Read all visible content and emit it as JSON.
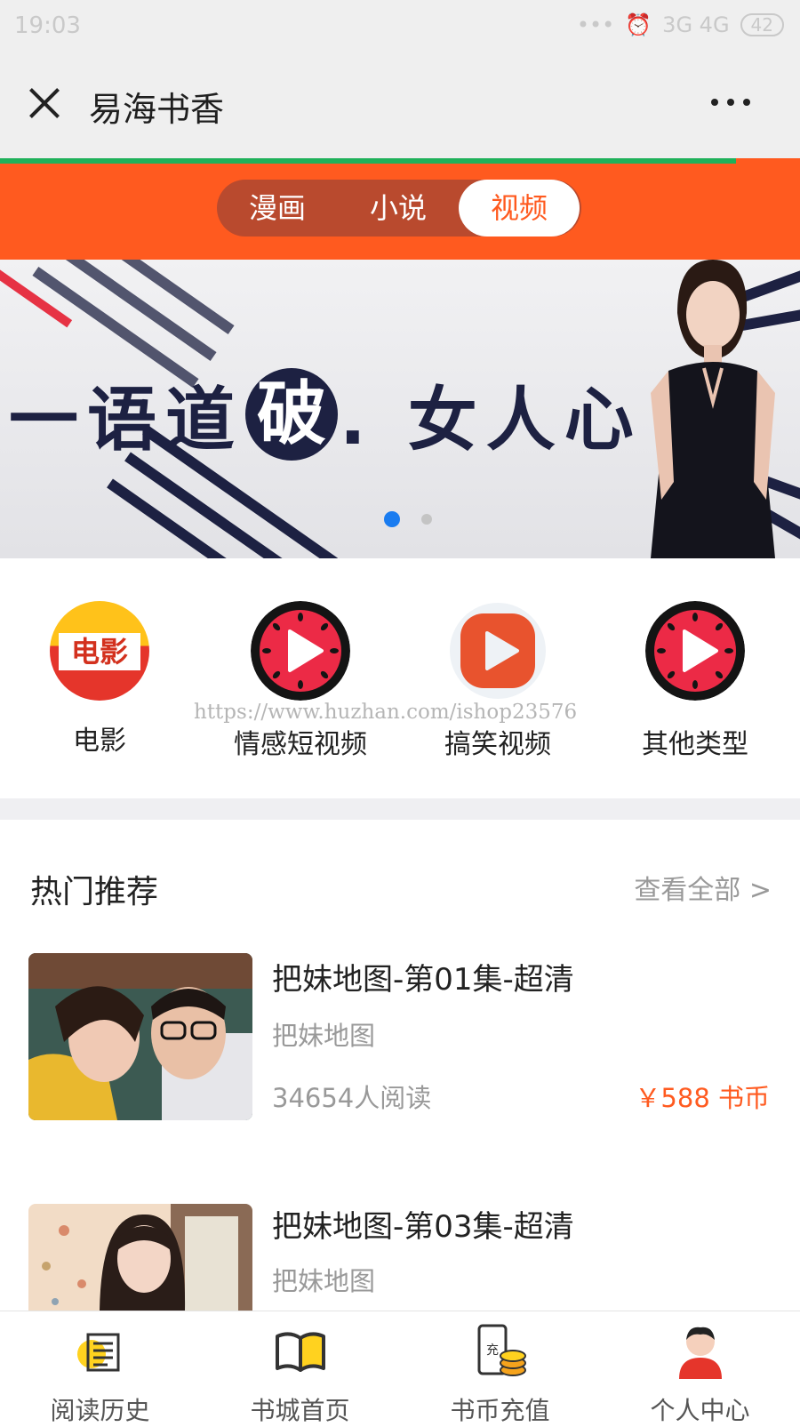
{
  "status_bar": {
    "time": "19:03",
    "signals": "3G  4G",
    "battery": "42"
  },
  "header": {
    "title": "易海书香"
  },
  "progress_fraction": 0.92,
  "tabs": [
    {
      "label": "漫画",
      "active": false
    },
    {
      "label": "小说",
      "active": false
    },
    {
      "label": "视频",
      "active": true
    }
  ],
  "banner": {
    "text_before": "一语道",
    "text_circle": "破",
    "text_after": ". 女人心",
    "slides_total": 2,
    "active_slide": 1
  },
  "categories": [
    {
      "label": "电影",
      "icon": "movie-icon",
      "badge": "电影"
    },
    {
      "label": "情感短视频",
      "icon": "watermelon-play-icon"
    },
    {
      "label": "搞笑视频",
      "icon": "orange-play-icon"
    },
    {
      "label": "其他类型",
      "icon": "watermelon-play-icon"
    }
  ],
  "watermark": "https://www.huzhan.com/ishop23576",
  "section": {
    "title": "热门推荐",
    "view_all": "查看全部 >"
  },
  "items": [
    {
      "title": "把妹地图-第01集-超清",
      "subtitle": "把妹地图",
      "reads": "34654人阅读",
      "price": "￥588 书币"
    },
    {
      "title": "把妹地图-第03集-超清",
      "subtitle": "把妹地图"
    }
  ],
  "bottom_nav": [
    {
      "label": "阅读历史",
      "icon": "history-icon"
    },
    {
      "label": "书城首页",
      "icon": "book-icon"
    },
    {
      "label": "书币充值",
      "icon": "recharge-icon",
      "icon_text": "充"
    },
    {
      "label": "个人中心",
      "icon": "user-icon"
    }
  ],
  "colors": {
    "accent": "#ff5a1f",
    "progress": "#1fb15a",
    "banner_ink": "#1d2142",
    "dot_active": "#1a7cf0"
  }
}
